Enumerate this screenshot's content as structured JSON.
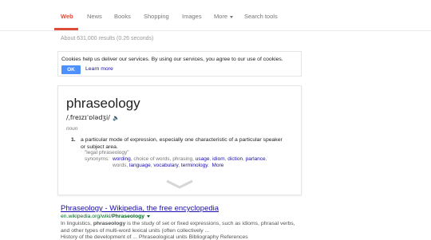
{
  "tabs": [
    {
      "label": "Web"
    },
    {
      "label": "News"
    },
    {
      "label": "Books"
    },
    {
      "label": "Shopping"
    },
    {
      "label": "Images"
    },
    {
      "label": "More"
    },
    {
      "label": "Search tools"
    }
  ],
  "stats": "About 631,000 results (0.26 seconds)",
  "cookie": {
    "text": "Cookies help us deliver our services. By using our services, you agree to our use of cookies.",
    "ok": "OK",
    "learn_more": "Learn more"
  },
  "dictionary": {
    "word": "phraseology",
    "pronunciation": "/ˌfreɪzɪˈɒlədʒi/",
    "part_of_speech": "noun",
    "definition_number": "1.",
    "definition": "a particular mode of expression, especially one characteristic of a particular speaker or subject area.",
    "example": "\"legal phraseology\"",
    "synonyms_label": "synonyms:",
    "synonyms": [
      "wording",
      "choice of words",
      "phrasing",
      "usage",
      "idiom",
      "diction",
      "parlance",
      "words",
      "language",
      "vocabulary",
      "terminology"
    ],
    "more": "More"
  },
  "result": {
    "title": "Phraseology - Wikipedia, the free encyclopedia",
    "url_prefix": "en.wikipedia.org/wiki/",
    "url_bold": "Phraseology",
    "snippet_bold": "In linguistics,",
    "snippet_text": "phraseology is the study of set or fixed expressions, such as idioms, phrasal verbs, and other types of multi-word lexical units (often collectively ...",
    "snippet_cut": "History of the development of ...   Phraseological units   Bibliography   References"
  },
  "colors": {
    "accent": "#dd4b39",
    "link": "#1a0dab",
    "url": "#006621",
    "button": "#4d90fe"
  }
}
